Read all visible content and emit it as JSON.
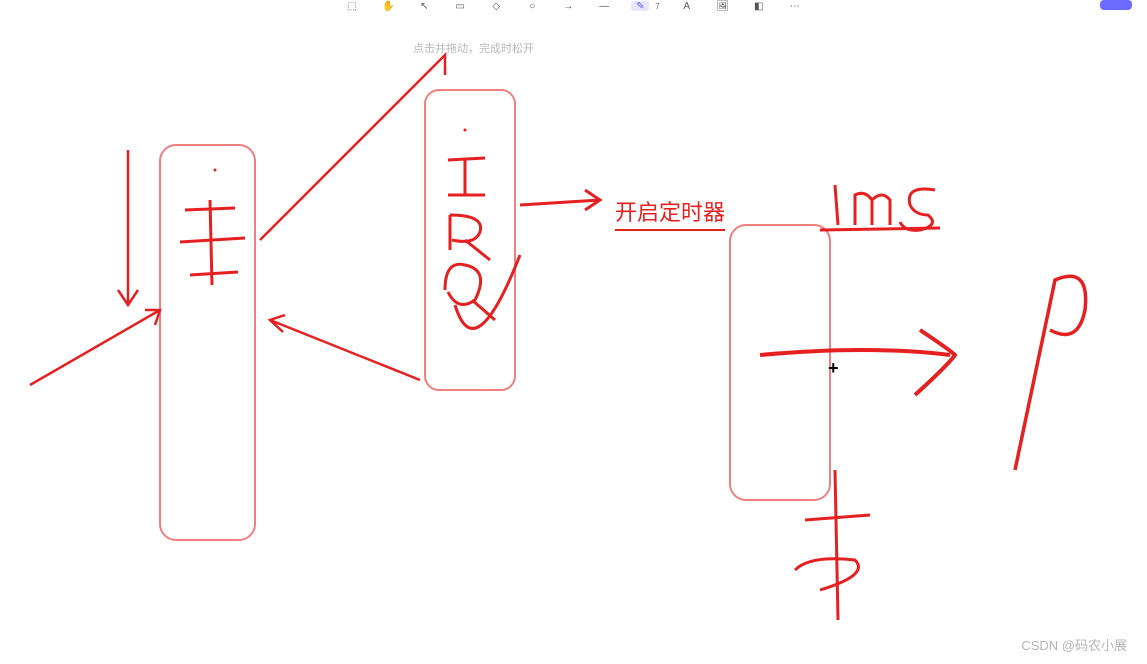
{
  "toolbar": {
    "items": [
      {
        "name": "select-icon",
        "glyph": "⬚"
      },
      {
        "name": "hand-icon",
        "glyph": "✋"
      },
      {
        "name": "pointer-icon",
        "glyph": "↖"
      },
      {
        "name": "rect-icon",
        "glyph": "▭"
      },
      {
        "name": "diamond-icon",
        "glyph": "◇"
      },
      {
        "name": "circle-icon",
        "glyph": "○"
      },
      {
        "name": "arrow-icon",
        "glyph": "→"
      },
      {
        "name": "line-icon",
        "glyph": "—"
      },
      {
        "name": "pen-icon",
        "glyph": "✎",
        "active": true,
        "number": "7"
      },
      {
        "name": "text-icon",
        "glyph": "A"
      },
      {
        "name": "image-icon",
        "glyph": "🖼"
      },
      {
        "name": "eraser-icon",
        "glyph": "◧"
      },
      {
        "name": "more-icon",
        "glyph": "⋯"
      }
    ]
  },
  "hint": "点击并拖动，完成时松开",
  "annotations": {
    "timer_label": "开启定时器",
    "handwritten_1": "主",
    "handwritten_2": "IRQ",
    "handwritten_3": "1ms",
    "handwritten_4": "P",
    "handwritten_5": "卡"
  },
  "watermark": "CSDN @码农小展",
  "colors": {
    "stroke": "#e62020",
    "stroke_light": "#f08080"
  }
}
